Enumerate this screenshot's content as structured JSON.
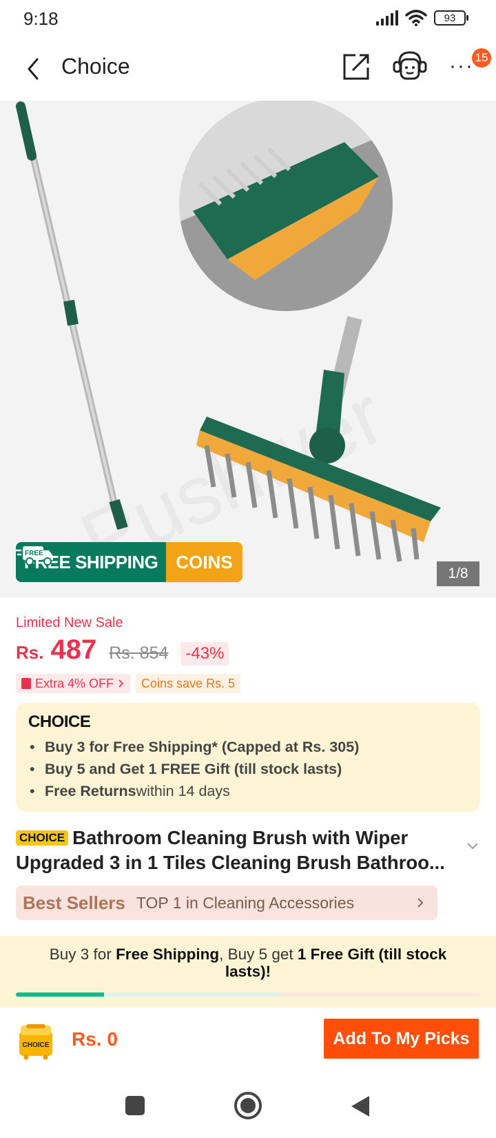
{
  "status_bar": {
    "time": "9:18",
    "battery": "93"
  },
  "nav": {
    "title": "Choice",
    "cart_badge": "15"
  },
  "gallery": {
    "free_shipping_label": "FREE SHIPPING",
    "free_tag": "FREE",
    "coins_label": "COINS",
    "page_indicator": "1/8",
    "watermark": "Pushwer"
  },
  "price": {
    "sale_label": "Limited New Sale",
    "currency": "Rs.",
    "current": "487",
    "original": "Rs. 854",
    "discount": "-43%",
    "extra_off": "Extra 4% OFF",
    "coins_save": "Coins save Rs. 5"
  },
  "choice": {
    "logo": "CHOICE",
    "benefits": [
      {
        "bold": "Buy 3 for  Free Shipping* (Capped at Rs. 305)",
        "rest": ""
      },
      {
        "bold": "Buy 5 and Get 1 FREE Gift (till stock lasts)",
        "rest": ""
      },
      {
        "bold": "Free Returns",
        "rest": " within 14 days"
      }
    ]
  },
  "product": {
    "badge": "CHOICE",
    "title": "Bathroom Cleaning Brush with Wiper Upgraded 3 in 1 Tiles Cleaning Brush Bathroo..."
  },
  "best_sellers": {
    "label": "Best Sellers",
    "rank": "TOP 1 in Cleaning Accessories"
  },
  "promo": {
    "p1": "Buy 3 for ",
    "b1": "Free Shipping",
    "p2": ", Buy 5 get ",
    "b2": "1 Free Gift (till stock lasts)!",
    "progress_fill_fraction": 0.19,
    "progress_mid_fraction": 0.57
  },
  "cart": {
    "icon_label": "CHOICE",
    "total": "Rs. 0",
    "add_button": "Add To My Picks"
  },
  "colors": {
    "accent_red": "#e8334f",
    "orange": "#ff4d0a",
    "green": "#0a7a5f",
    "gold": "#f2a316"
  }
}
